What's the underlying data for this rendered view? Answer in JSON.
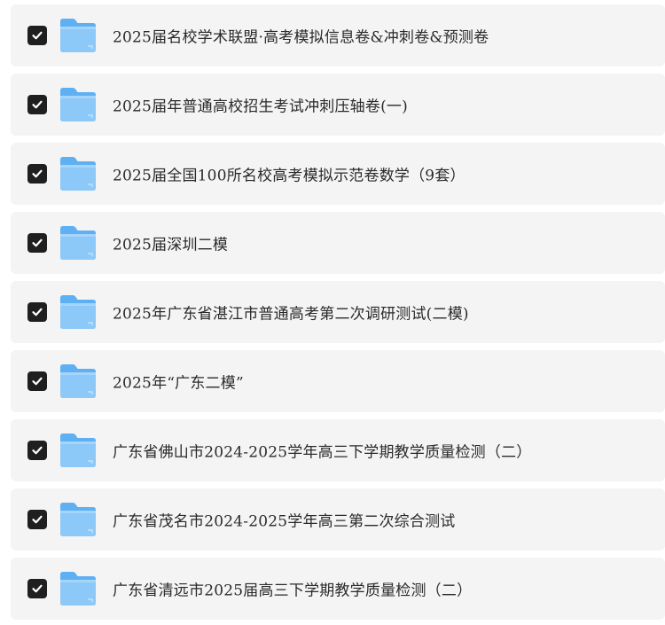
{
  "items": [
    {
      "label": "2025届名校学术联盟·高考模拟信息卷&冲刺卷&预测卷",
      "checked": true,
      "icon": "folder-icon"
    },
    {
      "label": "2025届年普通高校招生考试冲刺压轴卷(一)",
      "checked": true,
      "icon": "folder-icon"
    },
    {
      "label": "2025届全国100所名校高考模拟示范卷数学（9套）",
      "checked": true,
      "icon": "folder-icon"
    },
    {
      "label": "2025届深圳二模",
      "checked": true,
      "icon": "folder-icon"
    },
    {
      "label": "2025年广东省湛江市普通高考第二次调研测试(二模)",
      "checked": true,
      "icon": "folder-icon"
    },
    {
      "label": "2025年“广东二模”",
      "checked": true,
      "icon": "folder-icon"
    },
    {
      "label": "广东省佛山市2024-2025学年高三下学期教学质量检测（二）",
      "checked": true,
      "icon": "folder-icon"
    },
    {
      "label": "广东省茂名市2024-2025学年高三第二次综合测试",
      "checked": true,
      "icon": "folder-icon"
    },
    {
      "label": "广东省清远市2025届高三下学期教学质量检测（二）",
      "checked": true,
      "icon": "folder-icon"
    }
  ],
  "colors": {
    "row_background": "#f4f4f5",
    "checkbox": "#1f1f1f",
    "folder_front": "#8cc8f8",
    "folder_back": "#5fb0f2",
    "text": "#2a2a2a"
  }
}
